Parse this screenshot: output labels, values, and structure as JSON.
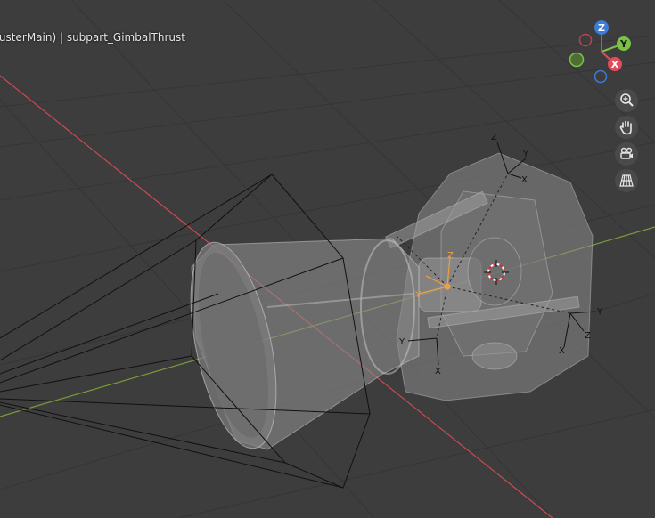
{
  "viewport": {
    "header_text": "rusterMain) | subpart_GimbalThrust",
    "navigation_gizmo": {
      "z_label": "Z",
      "y_label": "Y",
      "x_label": "X"
    },
    "nav_buttons": [
      {
        "icon": "zoom-icon"
      },
      {
        "icon": "hand-pan-icon"
      },
      {
        "icon": "camera-view-icon"
      },
      {
        "icon": "perspective-grid-icon"
      }
    ],
    "empties": {
      "empty_top": {
        "z": "Z",
        "y": "Y",
        "x": "X"
      },
      "empty_right": {
        "y": "Y",
        "z": "Z",
        "x": "X"
      },
      "empty_bottom": {
        "y": "Y",
        "x": "X"
      },
      "empty_pivot": {
        "z": "Z",
        "y": "Y"
      }
    },
    "colors": {
      "background": "#3d3d3d",
      "x_axis": "#c84b55",
      "y_axis": "#7a9a3a",
      "selection": "#f0a040",
      "gizmo_z": "#3c7dd9",
      "gizmo_y": "#7ac146",
      "gizmo_x": "#e44b5a"
    }
  }
}
